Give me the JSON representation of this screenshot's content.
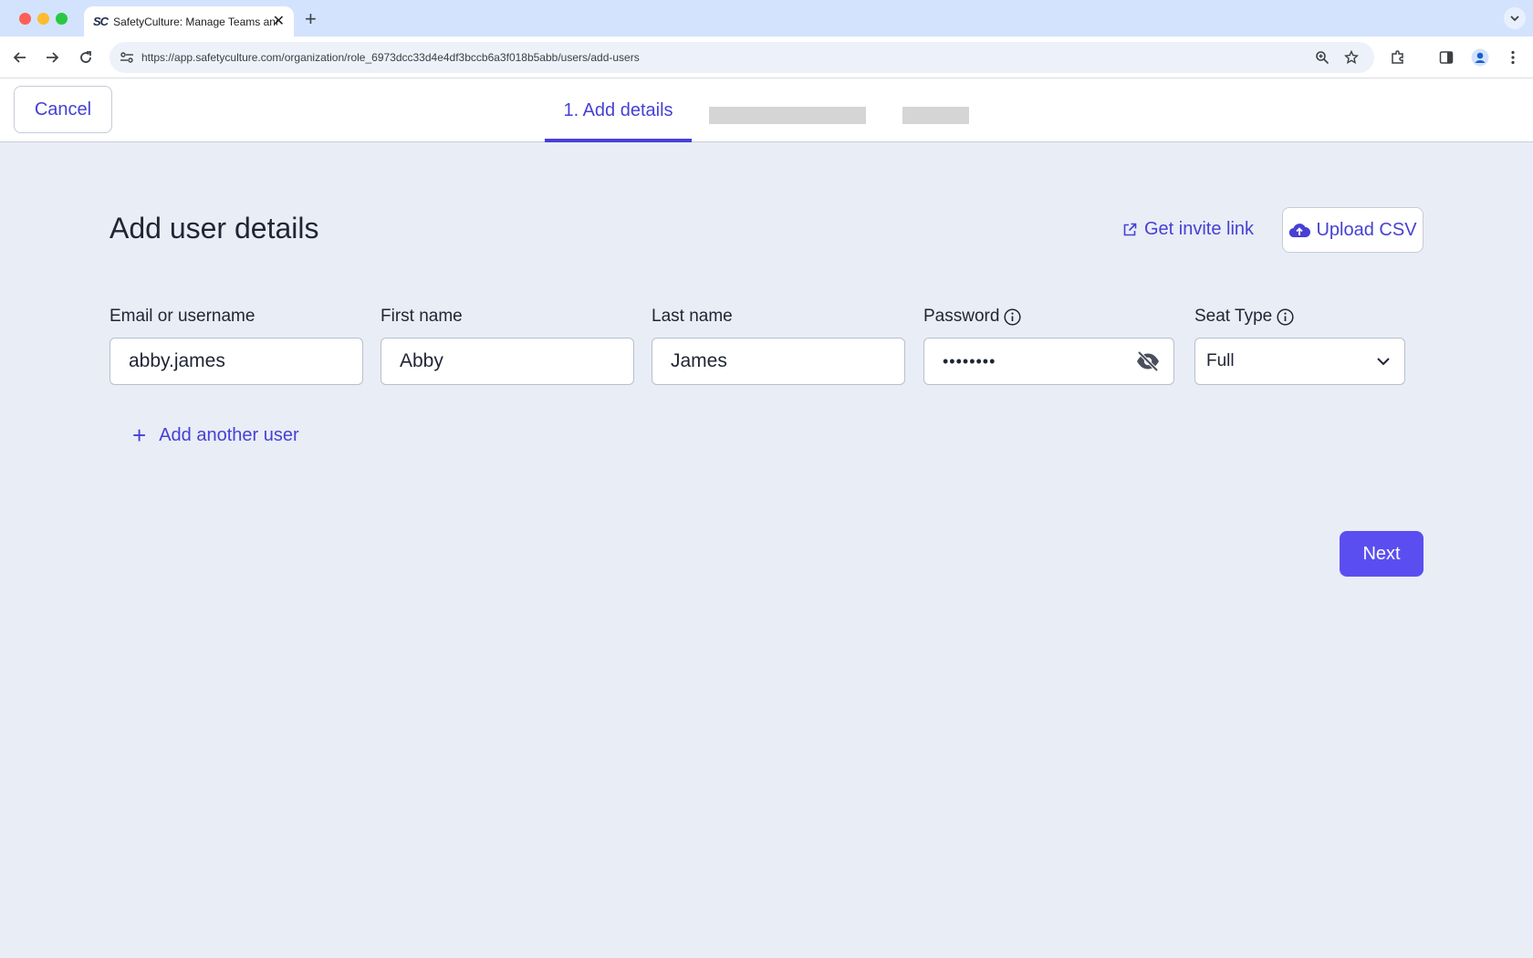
{
  "browser": {
    "tab_title": "SafetyCulture: Manage Teams and...",
    "tab_favicon_text": "SC",
    "url": "https://app.safetyculture.com/organization/role_6973dcc33d4e4df3bccb6a3f018b5abb/users/add-users",
    "icons": [
      "back-icon",
      "forward-icon",
      "reload-icon",
      "site-settings-icon",
      "zoom-icon",
      "bookmark-star-icon",
      "extensions-icon",
      "side-panel-icon",
      "profile-icon",
      "menu-dots-icon"
    ]
  },
  "header": {
    "cancel_label": "Cancel",
    "steps": [
      {
        "label": "1. Add details",
        "active": true
      }
    ]
  },
  "main": {
    "title": "Add user details",
    "invite_link_label": "Get invite link",
    "upload_csv_label": "Upload CSV",
    "fields": {
      "email": {
        "label": "Email or username",
        "value": "abby.james"
      },
      "first_name": {
        "label": "First name",
        "value": "Abby"
      },
      "last_name": {
        "label": "Last name",
        "value": "James"
      },
      "password": {
        "label": "Password",
        "value": "••••••••"
      },
      "seat_type": {
        "label": "Seat Type",
        "value": "Full"
      }
    },
    "add_another_label": "Add another user",
    "next_label": "Next"
  },
  "colors": {
    "accent": "#4740d4",
    "primary_button": "#5b4ef0",
    "page_background": "#e9edf6",
    "tabbar": "#d3e3fd"
  }
}
